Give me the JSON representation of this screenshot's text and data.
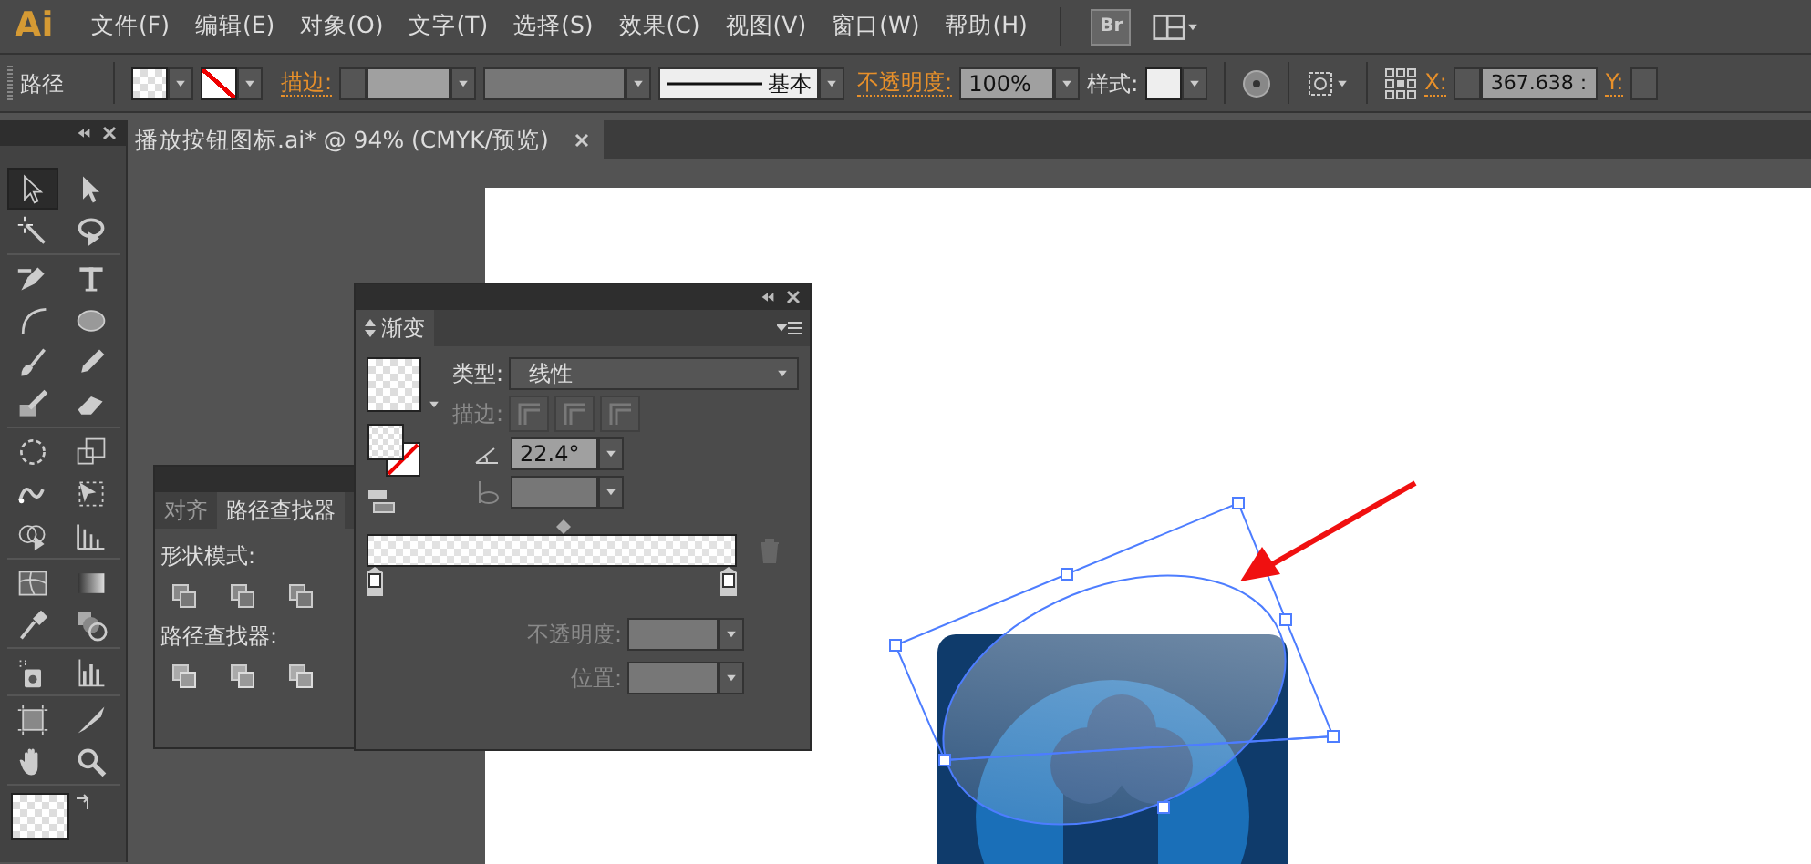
{
  "app_logo": "Ai",
  "menu": [
    "文件(F)",
    "编辑(E)",
    "对象(O)",
    "文字(T)",
    "选择(S)",
    "效果(C)",
    "视图(V)",
    "窗口(W)",
    "帮助(H)"
  ],
  "bridge_button": "Br",
  "control_bar": {
    "selection_label": "路径",
    "stroke_label": "描边:",
    "stroke_style": "基本",
    "opacity_label": "不透明度:",
    "opacity": "100%",
    "style_label": "样式:",
    "x_label": "X:",
    "x_value": "367.638 :",
    "y_label": "Y:"
  },
  "document_tab": {
    "title": "播放按钮图标.ai* @ 94% (CMYK/预览)"
  },
  "tools": [
    {
      "selected": true
    },
    {
      "selected": false
    },
    {
      "selected": false
    },
    {
      "selected": false
    },
    {
      "selected": false
    },
    {
      "selected": false
    },
    {
      "selected": false
    },
    {
      "selected": false
    },
    {
      "selected": false
    },
    {
      "selected": false
    },
    {
      "selected": false
    },
    {
      "selected": false
    },
    {
      "selected": false
    },
    {
      "selected": false
    },
    {
      "selected": false
    },
    {
      "selected": false
    },
    {
      "selected": false
    },
    {
      "selected": false
    },
    {
      "selected": false
    },
    {
      "selected": false
    },
    {
      "selected": false
    },
    {
      "selected": false
    },
    {
      "selected": false
    },
    {
      "selected": false
    },
    {
      "selected": false
    },
    {
      "selected": false
    },
    {
      "selected": false
    },
    {
      "selected": false
    }
  ],
  "pathfinder_panel": {
    "tabs": [
      {
        "label": "对齐",
        "selected": false
      },
      {
        "label": "路径查找器",
        "selected": true
      }
    ],
    "shape_modes_label": "形状模式:",
    "pathfinders_label": "路径查找器:"
  },
  "gradient_panel": {
    "tab": "渐变",
    "type_label": "类型:",
    "type": "线性",
    "stroke": {
      "label": "描边:",
      "disabled": true
    },
    "angle": "22.4°",
    "aspect_ratio": {
      "disabled": true
    },
    "opacity": {
      "label": "不透明度:",
      "disabled": true
    },
    "location": {
      "label": "位置:",
      "disabled": true
    }
  }
}
